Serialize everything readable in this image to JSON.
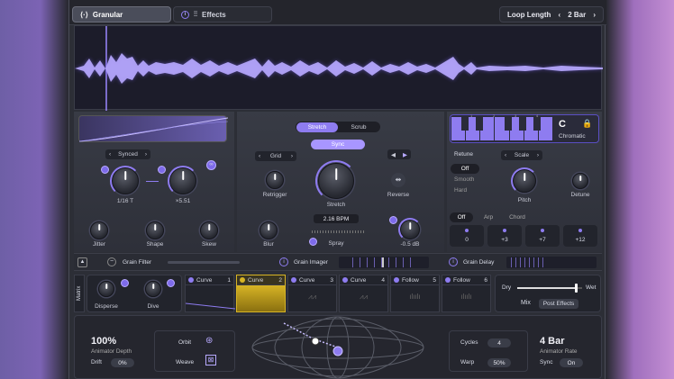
{
  "tabs": {
    "granular": "Granular",
    "effects": "Effects"
  },
  "loop": {
    "label": "Loop Length",
    "value": "2 Bar"
  },
  "sync_mode": "Synced",
  "rate_value": "1/16 T",
  "mult_value": "×5.51",
  "left_knobs": {
    "jitter": "Jitter",
    "shape": "Shape",
    "skew": "Skew"
  },
  "stretch_toggle": {
    "stretch": "Stretch",
    "scrub": "Scrub"
  },
  "sync_button": "Sync",
  "grid_mode": "Grid",
  "center_knobs": {
    "retrigger": "Retrigger",
    "stretch": "Stretch",
    "reverse": "Reverse",
    "blur": "Blur",
    "spray": "Spray"
  },
  "bpm": "2.16 BPM",
  "gain": "-0.5 dB",
  "keyboard": {
    "key": "C",
    "label": "Chromatic",
    "marks": [
      "1",
      "2",
      "3",
      "4"
    ]
  },
  "retune": {
    "label": "Retune",
    "options": [
      "Off",
      "Smooth",
      "Hard"
    ],
    "selected": "Off",
    "scale": "Scale"
  },
  "pitch_knobs": {
    "pitch": "Pitch",
    "detune": "Detune"
  },
  "chord_tabs": [
    "Off",
    "Arp",
    "Chord"
  ],
  "chord_values": [
    "0",
    "+3",
    "+7",
    "+12"
  ],
  "fx": {
    "grain_filter": "Grain Filter",
    "grain_imager": "Grain Imager",
    "grain_delay": "Grain Delay"
  },
  "matrix": {
    "label": "Matrix",
    "disperse": "Disperse",
    "dive": "Dive"
  },
  "slots": [
    {
      "name": "Curve",
      "num": "1"
    },
    {
      "name": "Curve",
      "num": "2"
    },
    {
      "name": "Curve",
      "num": "3"
    },
    {
      "name": "Curve",
      "num": "4"
    },
    {
      "name": "Follow",
      "num": "5"
    },
    {
      "name": "Follow",
      "num": "6"
    }
  ],
  "mix": {
    "dry": "Dry",
    "wet": "Wet",
    "label": "Mix",
    "post": "Post Effects",
    "level": 0.9
  },
  "animator": {
    "depth_value": "100%",
    "depth_label": "Animator Depth",
    "drift_label": "Drift",
    "drift_value": "0%",
    "orbit": "Orbit",
    "weave": "Weave",
    "cycles_label": "Cycles",
    "cycles_value": "4",
    "warp_label": "Warp",
    "warp_value": "50%",
    "rate_value": "4 Bar",
    "rate_label": "Animator Rate",
    "sync_label": "Sync",
    "sync_value": "On"
  },
  "colors": {
    "accent": "#8e7cf0",
    "wave": "#9b86ff",
    "slot_active": "#d7b425"
  },
  "icons": {
    "lock": "lock-icon",
    "info": "info-icon",
    "sliders": "sliders-icon"
  }
}
